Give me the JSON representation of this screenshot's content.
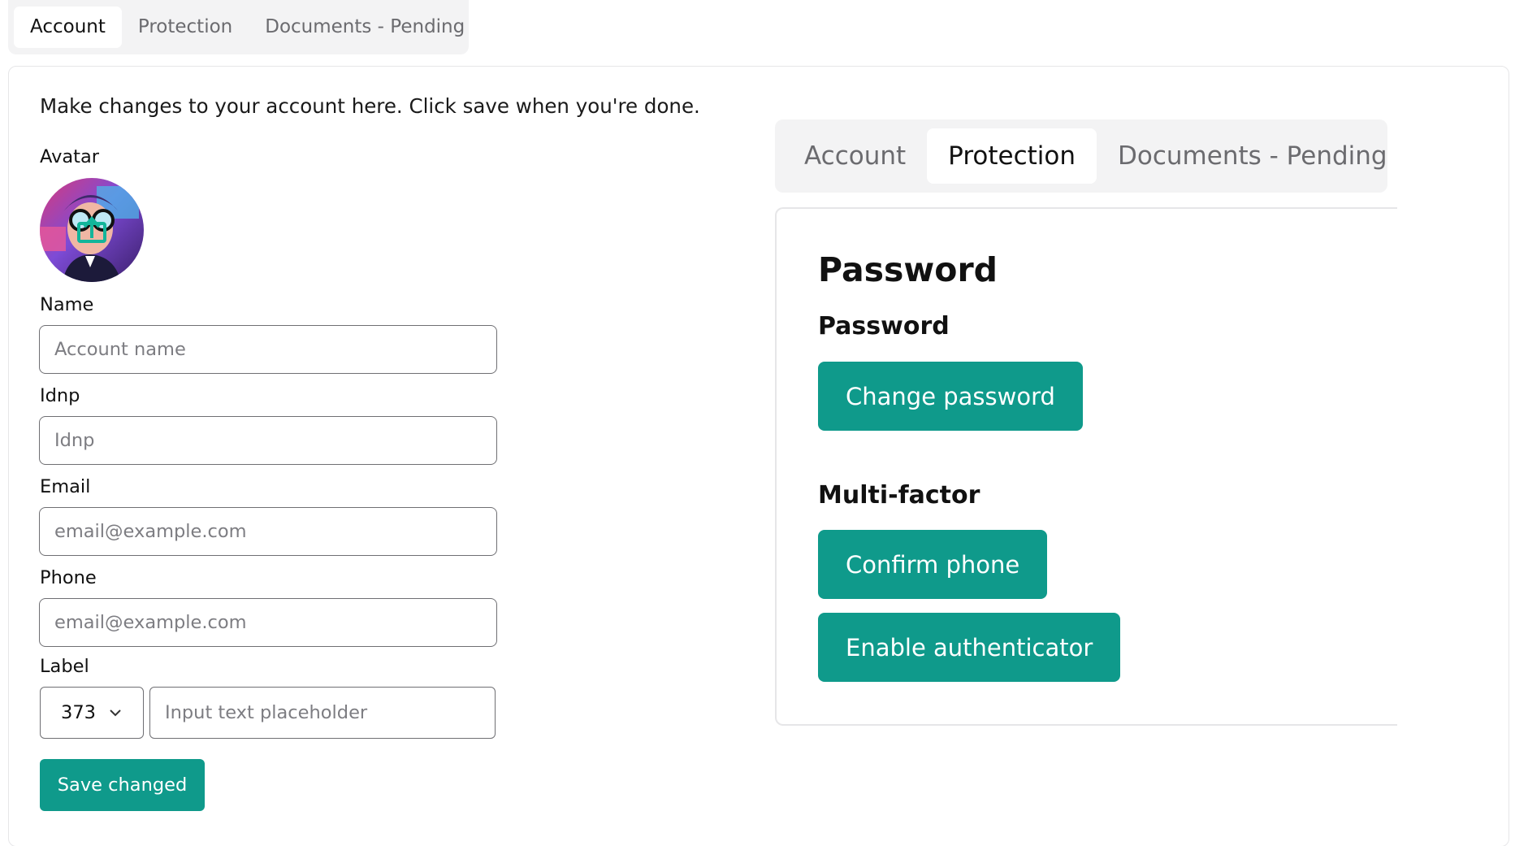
{
  "tabs": [
    {
      "label": "Account",
      "active": true
    },
    {
      "label": "Protection",
      "active": false
    },
    {
      "label": "Documents - Pending",
      "active": false
    }
  ],
  "account": {
    "description": "Make changes to your account here. Click save when you're done.",
    "avatar_label": "Avatar",
    "name_label": "Name",
    "name_placeholder": "Account name",
    "idnp_label": "Idnp",
    "idnp_placeholder": "Idnp",
    "email_label": "Email",
    "email_placeholder": "email@example.com",
    "phone_label": "Phone",
    "phone_placeholder": "email@example.com",
    "label_label": "Label",
    "label_select_value": "373",
    "label_input_placeholder": "Input text placeholder",
    "save_button": "Save changed"
  },
  "protection_panel": {
    "tabs": [
      {
        "label": "Account",
        "active": false
      },
      {
        "label": "Protection",
        "active": true
      },
      {
        "label": "Documents - Pending",
        "active": false
      }
    ],
    "title": "Password",
    "password_section": "Password",
    "change_password_button": "Change password",
    "mfa_section": "Multi-factor",
    "confirm_phone_button": "Confirm phone",
    "enable_authenticator_button": "Enable authenticator"
  },
  "colors": {
    "accent": "#0f9a8b",
    "tab_bar_bg": "#f3f3f4",
    "border": "#e6e6e8",
    "input_border": "#6f6f73"
  },
  "icons": {
    "select_chevron": "chevron-down-icon",
    "avatar_overlay": "upload-icon"
  }
}
